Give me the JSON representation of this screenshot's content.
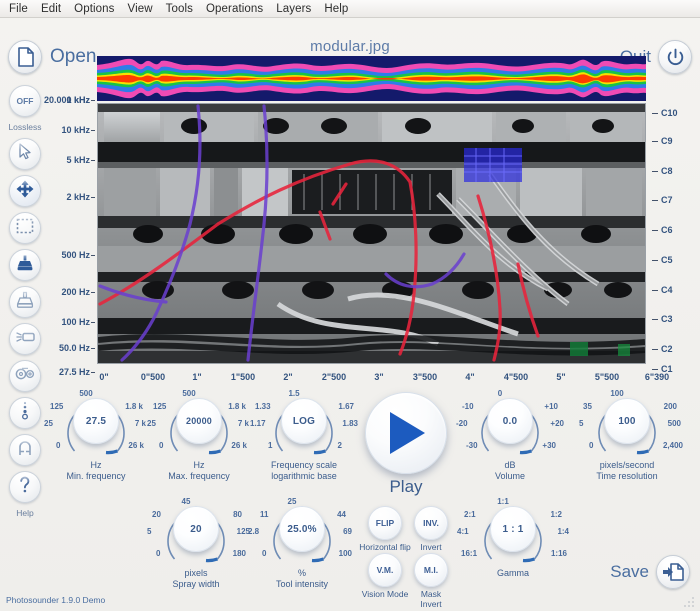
{
  "menubar": {
    "items": [
      "File",
      "Edit",
      "Options",
      "View",
      "Tools",
      "Operations",
      "Layers",
      "Help"
    ]
  },
  "toolbar": {
    "open_label": "Open",
    "open_icon": "document-icon",
    "title": "modular.jpg",
    "quit_label": "Quit",
    "quit_icon": "power-icon"
  },
  "rail": {
    "off_label": "OFF",
    "lossless_label": "Lossless",
    "help_label": "Help",
    "tools": [
      {
        "name": "cursor-tool",
        "icon": "arrow-cursor-icon"
      },
      {
        "name": "move-tool",
        "icon": "four-arrows-move-icon"
      },
      {
        "name": "select-tool",
        "icon": "dashed-rectangle-select-icon"
      },
      {
        "name": "paint-tool",
        "icon": "filled-stamp-icon"
      },
      {
        "name": "eraser-tool",
        "icon": "empty-stamp-icon"
      },
      {
        "name": "spray-tool",
        "icon": "spray-can-icon"
      },
      {
        "name": "gears-tool",
        "icon": "gears-icon"
      },
      {
        "name": "dots-tool",
        "icon": "vertical-dots-icon"
      },
      {
        "name": "magnet-tool",
        "icon": "magnet-icon"
      },
      {
        "name": "help-tool",
        "icon": "question-mark-icon"
      }
    ]
  },
  "spectrogram": {
    "frequency_labels": [
      "20.000 kHz",
      "10 kHz",
      "5 kHz",
      "2 kHz",
      "1 kHz",
      "500 Hz",
      "200 Hz",
      "100 Hz",
      "50.0 Hz",
      "27.5 Hz"
    ],
    "note_labels": [
      "C10",
      "C9",
      "C8",
      "C7",
      "C6",
      "C5",
      "C4",
      "C3",
      "C2",
      "C1"
    ],
    "time_labels": [
      "0\"",
      "0\"500",
      "1\"",
      "1\"500",
      "2\"",
      "2\"500",
      "3\"",
      "3\"500",
      "4\"",
      "4\"500",
      "5\"",
      "5\"500",
      "6\"390"
    ]
  },
  "knobs": [
    {
      "name": "min-frequency-knob",
      "value": "27.5",
      "unit": "Hz",
      "caption": "Min. frequency",
      "ticks": [
        "0",
        "25",
        "125",
        "500",
        "1.8 k",
        "7 k",
        "26 k"
      ]
    },
    {
      "name": "max-frequency-knob",
      "value": "20000",
      "unit": "Hz",
      "caption": "Max. frequency",
      "ticks": [
        "0",
        "25",
        "125",
        "500",
        "1.8 k",
        "7 k",
        "26 k"
      ]
    },
    {
      "name": "frequency-scale-log-base-knob",
      "value": "LOG",
      "unit": "Frequency scale",
      "caption": "logarithmic base",
      "ticks": [
        "1",
        "1.17",
        "1.33",
        "1.5",
        "1.67",
        "1.83",
        "2"
      ]
    },
    {
      "name": "volume-knob",
      "value": "0.0",
      "unit": "dB",
      "caption": "Volume",
      "ticks": [
        "-30",
        "-20",
        "-10",
        "0",
        "+10",
        "+20",
        "+30"
      ]
    },
    {
      "name": "time-resolution-knob",
      "value": "100",
      "unit": "pixels/second",
      "caption": "Time resolution",
      "ticks": [
        "0",
        "5",
        "35",
        "100",
        "200",
        "500",
        "2,400"
      ]
    },
    {
      "name": "spray-width-knob",
      "value": "20",
      "unit": "pixels",
      "caption": "Spray width",
      "ticks": [
        "0",
        "5",
        "20",
        "45",
        "80",
        "125",
        "180"
      ]
    },
    {
      "name": "tool-intensity-knob",
      "value": "25.0%",
      "unit": "%",
      "caption": "Tool intensity",
      "ticks": [
        "0",
        "2.8",
        "11",
        "25",
        "44",
        "69",
        "100"
      ]
    },
    {
      "name": "gamma-knob",
      "value": "1 : 1",
      "unit": "",
      "caption": "Gamma",
      "ticks": [
        "16:1",
        "4:1",
        "2:1",
        "1:1",
        "1:2",
        "1:4",
        "1:16"
      ]
    }
  ],
  "play": {
    "label": "Play",
    "icon": "play-triangle-icon"
  },
  "toggles": [
    {
      "name": "horizontal-flip-button",
      "short": "FLIP",
      "caption": "Horizontal flip"
    },
    {
      "name": "invert-button",
      "short": "INV.",
      "caption": "Invert"
    },
    {
      "name": "vision-mode-button",
      "short": "V.M.",
      "caption": "Vision Mode"
    },
    {
      "name": "mask-invert-button",
      "short": "M.I.",
      "caption": "Mask\nInvert"
    }
  ],
  "toggle_captions": {
    "horizontal_flip": "Horizontal flip",
    "invert": "Invert",
    "vision_mode": "Vision Mode",
    "mask_invert_line1": "Mask",
    "mask_invert_line2": "Invert"
  },
  "save": {
    "label": "Save",
    "icon": "save-document-icon"
  },
  "footer": {
    "version": "Photosounder 1.9.0 Demo"
  },
  "colors": {
    "accent": "#33537f",
    "panel": "#f2f1ee",
    "waveband_bg": "#141a6b",
    "play_blue": "#1c5bbf"
  }
}
